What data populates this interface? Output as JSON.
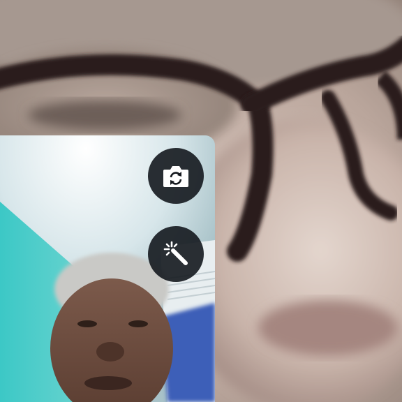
{
  "call": {
    "remote_video": {
      "description_icon": "remote-participant-video"
    },
    "self_view": {
      "icon": "local-camera-preview"
    },
    "controls": {
      "switch_camera_icon": "camera-switch-icon",
      "effects_icon": "magic-wand-icon"
    }
  },
  "colors": {
    "control_background": "#14181e",
    "icon_color": "#ffffff"
  }
}
